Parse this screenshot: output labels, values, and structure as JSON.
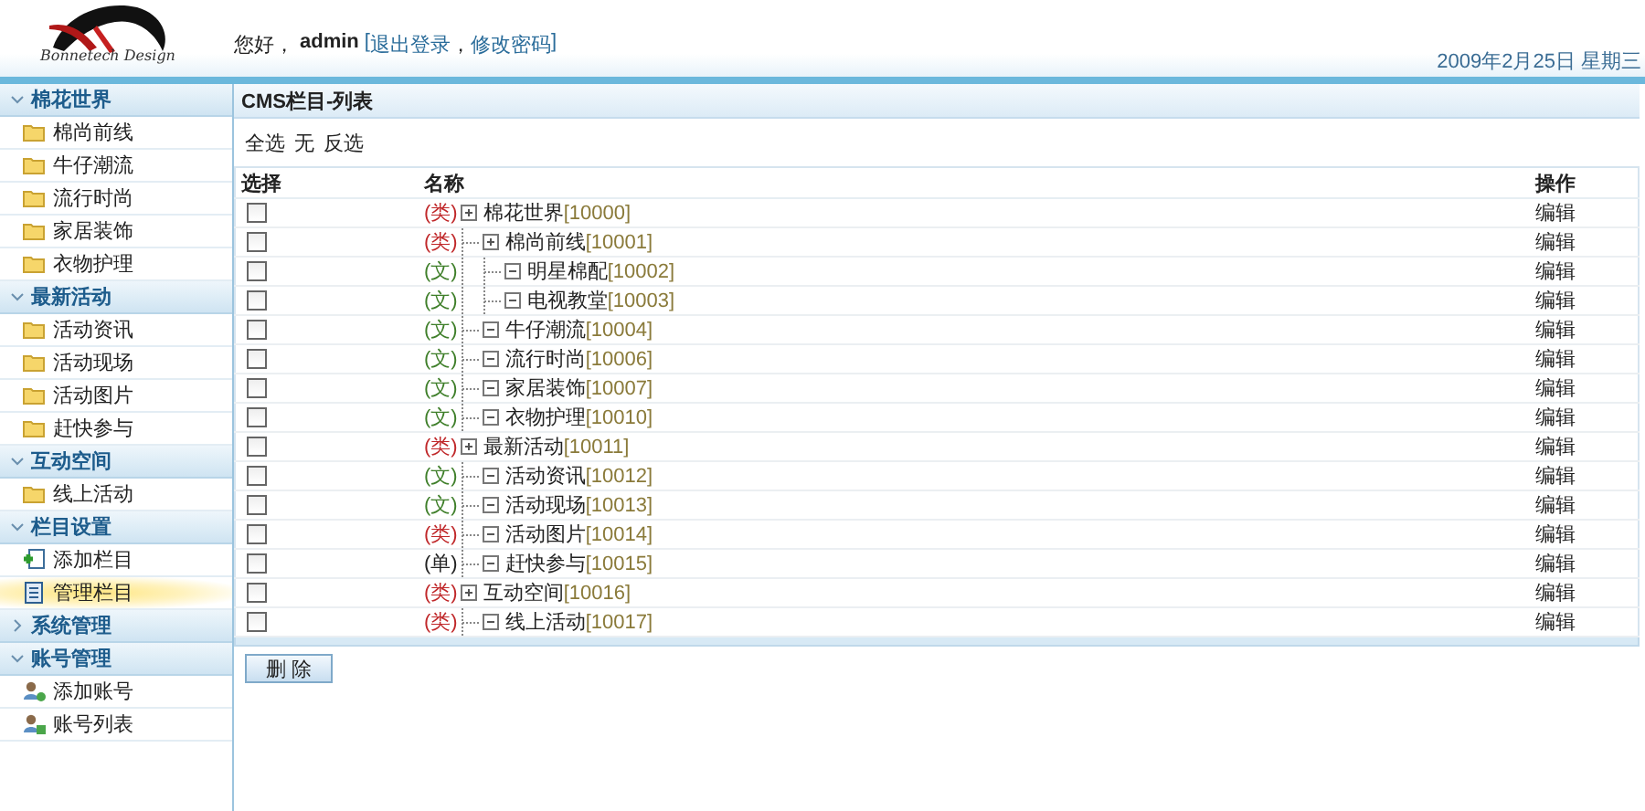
{
  "header": {
    "logo_text": "Bonnetech Design",
    "greeting": "您好，",
    "user": "admin",
    "links_open": "[",
    "links": [
      "退出登录",
      "修改密码"
    ],
    "links_sep": "，",
    "links_close": "]",
    "date": "2009年2月25日 星期三"
  },
  "sidebar": {
    "sections": [
      {
        "title": "棉花世界",
        "expanded": true,
        "items": [
          {
            "label": "棉尚前线",
            "kind": "folder",
            "selected": false
          },
          {
            "label": "牛仔潮流",
            "kind": "folder",
            "selected": false
          },
          {
            "label": "流行时尚",
            "kind": "folder",
            "selected": false
          },
          {
            "label": "家居装饰",
            "kind": "folder",
            "selected": false
          },
          {
            "label": "衣物护理",
            "kind": "folder",
            "selected": false
          }
        ]
      },
      {
        "title": "最新活动",
        "expanded": true,
        "items": [
          {
            "label": "活动资讯",
            "kind": "folder",
            "selected": false
          },
          {
            "label": "活动现场",
            "kind": "folder",
            "selected": false
          },
          {
            "label": "活动图片",
            "kind": "folder",
            "selected": false
          },
          {
            "label": "赶快参与",
            "kind": "folder",
            "selected": false
          }
        ]
      },
      {
        "title": "互动空间",
        "expanded": true,
        "items": [
          {
            "label": "线上活动",
            "kind": "folder",
            "selected": false
          }
        ]
      },
      {
        "title": "栏目设置",
        "expanded": true,
        "items": [
          {
            "label": "添加栏目",
            "kind": "add",
            "selected": false
          },
          {
            "label": "管理栏目",
            "kind": "manage",
            "selected": true
          }
        ]
      },
      {
        "title": "系统管理",
        "expanded": false
      },
      {
        "title": "账号管理",
        "expanded": true,
        "items": [
          {
            "label": "添加账号",
            "kind": "user-add",
            "selected": false
          },
          {
            "label": "账号列表",
            "kind": "user-list",
            "selected": false
          }
        ]
      }
    ]
  },
  "main": {
    "title": "CMS栏目-列表",
    "select_links": [
      "全选",
      "无",
      "反选"
    ],
    "table": {
      "columns": [
        "选择",
        "名称",
        "操作"
      ],
      "rows": [
        {
          "tag": "(类)",
          "kind": "category",
          "name": "棉花世界",
          "id_label": "[10000]",
          "checked": false,
          "action": "编辑",
          "children": [
            {
              "tag": "(类)",
              "kind": "category",
              "name": "棉尚前线",
              "id_label": "[10001]",
              "checked": false,
              "action": "编辑",
              "children": [
                {
                  "tag": "(文)",
                  "kind": "article",
                  "name": "明星棉配",
                  "id_label": "[10002]",
                  "checked": false,
                  "action": "编辑"
                },
                {
                  "tag": "(文)",
                  "kind": "article",
                  "name": "电视教堂",
                  "id_label": "[10003]",
                  "checked": false,
                  "action": "编辑"
                }
              ]
            },
            {
              "tag": "(文)",
              "kind": "article",
              "name": "牛仔潮流",
              "id_label": "[10004]",
              "checked": false,
              "action": "编辑"
            },
            {
              "tag": "(文)",
              "kind": "article",
              "name": "流行时尚",
              "id_label": "[10006]",
              "checked": false,
              "action": "编辑"
            },
            {
              "tag": "(文)",
              "kind": "article",
              "name": "家居装饰",
              "id_label": "[10007]",
              "checked": false,
              "action": "编辑"
            },
            {
              "tag": "(文)",
              "kind": "article",
              "name": "衣物护理",
              "id_label": "[10010]",
              "checked": false,
              "action": "编辑"
            }
          ]
        },
        {
          "tag": "(类)",
          "kind": "category",
          "name": "最新活动",
          "id_label": "[10011]",
          "checked": false,
          "action": "编辑",
          "children": [
            {
              "tag": "(文)",
              "kind": "article",
              "name": "活动资讯",
              "id_label": "[10012]",
              "checked": false,
              "action": "编辑"
            },
            {
              "tag": "(文)",
              "kind": "article",
              "name": "活动现场",
              "id_label": "[10013]",
              "checked": false,
              "action": "编辑"
            },
            {
              "tag": "(类)",
              "kind": "category",
              "name": "活动图片",
              "id_label": "[10014]",
              "checked": false,
              "action": "编辑"
            },
            {
              "tag": "(单)",
              "kind": "page",
              "name": "赶快参与",
              "id_label": "[10015]",
              "checked": false,
              "action": "编辑"
            }
          ]
        },
        {
          "tag": "(类)",
          "kind": "category",
          "name": "互动空间",
          "id_label": "[10016]",
          "checked": false,
          "action": "编辑",
          "children": [
            {
              "tag": "(类)",
              "kind": "category",
              "name": "线上活动",
              "id_label": "[10017]",
              "checked": false,
              "action": "编辑"
            }
          ]
        }
      ]
    },
    "delete_button": "删 除"
  }
}
